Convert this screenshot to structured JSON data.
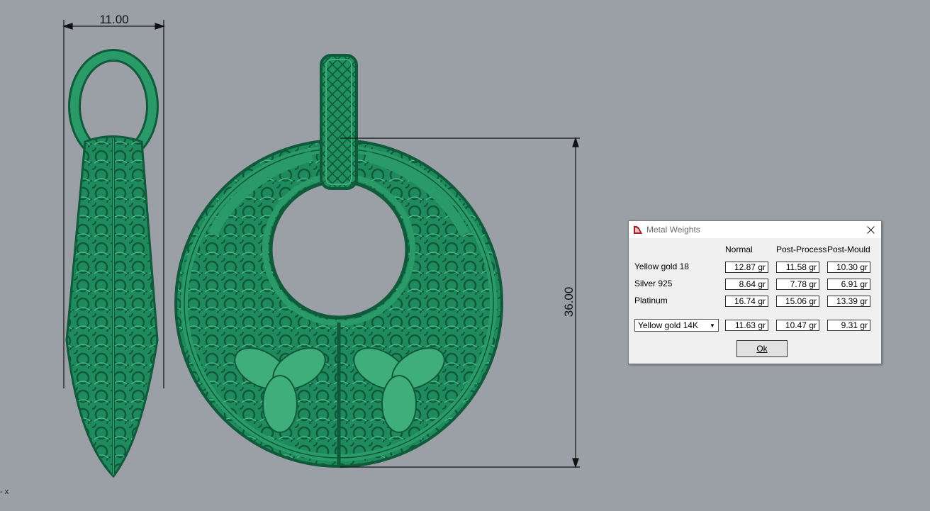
{
  "viewport": {
    "dimension_width_label": "11.00",
    "dimension_height_label": "36.00",
    "axis_marker": "x"
  },
  "colors": {
    "background": "#9aa0a6",
    "model_green": "#1f8a5c",
    "model_dark": "#0f5a3a",
    "model_light": "#3fae7b"
  },
  "dialog": {
    "title": "Metal Weights",
    "title_icon": "app-icon",
    "close_icon": "close-icon",
    "columns": [
      "Normal",
      "Post-Process",
      "Post-Mould"
    ],
    "rows": [
      {
        "label": "Yellow gold 18",
        "values": [
          "12.87 gr",
          "11.58 gr",
          "10.30 gr"
        ]
      },
      {
        "label": "Silver 925",
        "values": [
          "8.64 gr",
          "7.78 gr",
          "6.91 gr"
        ]
      },
      {
        "label": "Platinum",
        "values": [
          "16.74 gr",
          "15.06 gr",
          "13.39 gr"
        ]
      }
    ],
    "select": {
      "value": "Yellow gold 14K",
      "values": [
        "11.63 gr",
        "10.47 gr",
        "9.31 gr"
      ]
    },
    "ok_label": "Ok"
  }
}
